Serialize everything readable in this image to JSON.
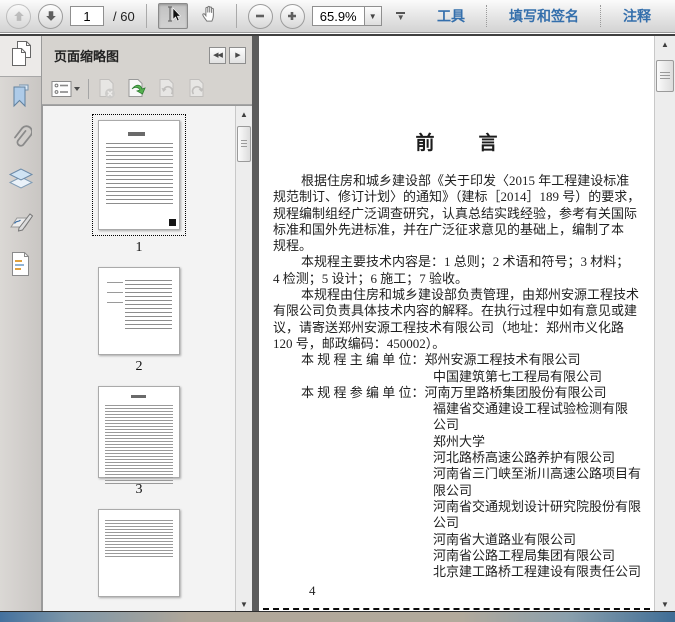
{
  "toolbar": {
    "page_current": "1",
    "page_total": "/ 60",
    "zoom_value": "65.9%",
    "links": [
      "工具",
      "填写和签名",
      "注释"
    ],
    "icons": [
      "previous-page-icon",
      "next-page-icon",
      "select-tool-icon",
      "hand-tool-icon",
      "zoom-out-icon",
      "zoom-in-icon",
      "zoom-dropdown-icon",
      "toolbar-overflow-icon"
    ]
  },
  "glyphs": {
    "down_triangle": "▼",
    "up_triangle": "▲",
    "collapse_left": "◀◀",
    "expand_right": "▶"
  },
  "sidebar": {
    "panel_title": "页面缩略图",
    "icon_strip": [
      "page-thumbnails-icon",
      "bookmarks-icon",
      "attachments-icon",
      "layers-icon",
      "signatures-icon",
      "comments-icon"
    ],
    "panel_tools": [
      "options-menu-icon",
      "delete-pages-icon",
      "extract-pages-icon",
      "rotate-left-icon",
      "rotate-right-icon"
    ],
    "thumbnails": [
      {
        "label": "1",
        "selected": true,
        "style": "p1"
      },
      {
        "label": "2",
        "selected": false,
        "style": "p2"
      },
      {
        "label": "3",
        "selected": false,
        "style": "p3"
      },
      {
        "label": "",
        "selected": false,
        "style": "p4"
      }
    ]
  },
  "document": {
    "title": "前　　言",
    "lines": [
      {
        "t": "indent",
        "s": "根据住房和城乡建设部《关于印发〈2015 年工程建设标准"
      },
      {
        "t": "plain",
        "s": "规范制订、修订计划〉的通知》（建标［2014］189 号）的要求，"
      },
      {
        "t": "plain",
        "s": "规程编制组经广泛调查研究，认真总结实践经验，参考有关国际"
      },
      {
        "t": "plain",
        "s": "标准和国外先进标准，并在广泛征求意见的基础上，编制了本"
      },
      {
        "t": "plain",
        "s": "规程。"
      },
      {
        "t": "indent",
        "s": "本规程主要技术内容是：1 总则；2 术语和符号；3 材料；"
      },
      {
        "t": "plain",
        "s": "4 检测；5 设计；6 施工；7 验收。"
      },
      {
        "t": "indent",
        "s": "本规程由住房和城乡建设部负责管理，由郑州安源工程技术"
      },
      {
        "t": "plain",
        "s": "有限公司负责具体技术内容的解释。在执行过程中如有意见或建"
      },
      {
        "t": "plain",
        "s": "议，请寄送郑州安源工程技术有限公司（地址：郑州市义化路"
      },
      {
        "t": "plain",
        "s": "120 号，邮政编码：450002）。"
      },
      {
        "t": "indent",
        "s": "本 规 程 主 编 单 位：郑州安源工程技术有限公司"
      },
      {
        "t": "cont",
        "s": "中国建筑第七工程局有限公司"
      },
      {
        "t": "indent",
        "s": "本 规 程 参 编 单 位：河南万里路桥集团股份有限公司"
      },
      {
        "t": "cont",
        "s": "福建省交通建设工程试验检测有限"
      },
      {
        "t": "cont",
        "s": "公司"
      },
      {
        "t": "cont",
        "s": "郑州大学"
      },
      {
        "t": "cont",
        "s": "河北路桥高速公路养护有限公司"
      },
      {
        "t": "cont",
        "s": "河南省三门峡至淅川高速公路项目有"
      },
      {
        "t": "cont",
        "s": "限公司"
      },
      {
        "t": "cont",
        "s": "河南省交通规划设计研究院股份有限"
      },
      {
        "t": "cont",
        "s": "公司"
      },
      {
        "t": "cont",
        "s": "河南省大道路业有限公司"
      },
      {
        "t": "cont",
        "s": "河南省公路工程局集团有限公司"
      },
      {
        "t": "cont",
        "s": "北京建工路桥工程建设有限责任公司"
      }
    ],
    "page_footer": "4"
  },
  "colors": {
    "link_blue": "#346fac",
    "divider_dark": "#5c5c5c",
    "toolbar_gray": "#e2e2e2",
    "extract_green": "#3fae49"
  }
}
